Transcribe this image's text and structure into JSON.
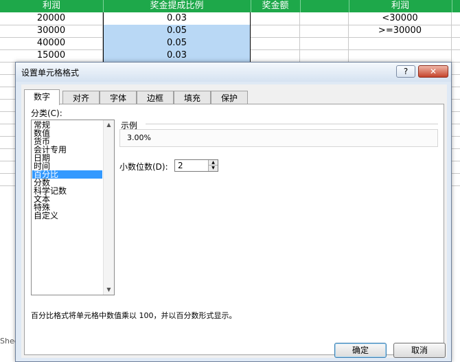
{
  "sheet": {
    "headers": [
      "利润",
      "奖金提成比例",
      "奖金额",
      "利润"
    ],
    "rows": [
      {
        "profit": "20000",
        "rate": "0.03",
        "cond": "<30000"
      },
      {
        "profit": "30000",
        "rate": "0.05",
        "cond": ">=30000"
      },
      {
        "profit": "40000",
        "rate": "0.05",
        "cond": ""
      },
      {
        "profit": "15000",
        "rate": "0.03",
        "cond": ""
      }
    ],
    "sheet_tab": "Shee"
  },
  "dialog": {
    "title": "设置单元格格式",
    "help_label": "?",
    "close_label": "✕",
    "tabs": [
      "数字",
      "对齐",
      "字体",
      "边框",
      "填充",
      "保护"
    ],
    "active_tab": 0,
    "category_label": "分类(C):",
    "categories": [
      "常规",
      "数值",
      "货币",
      "会计专用",
      "日期",
      "时间",
      "百分比",
      "分数",
      "科学记数",
      "文本",
      "特殊",
      "自定义"
    ],
    "selected_category": 6,
    "sample_label": "示例",
    "sample_value": "3.00%",
    "decimal_label": "小数位数(D):",
    "decimal_value": "2",
    "description": "百分比格式将单元格中数值乘以 100，并以百分数形式显示。",
    "ok_label": "确定",
    "cancel_label": "取消"
  }
}
